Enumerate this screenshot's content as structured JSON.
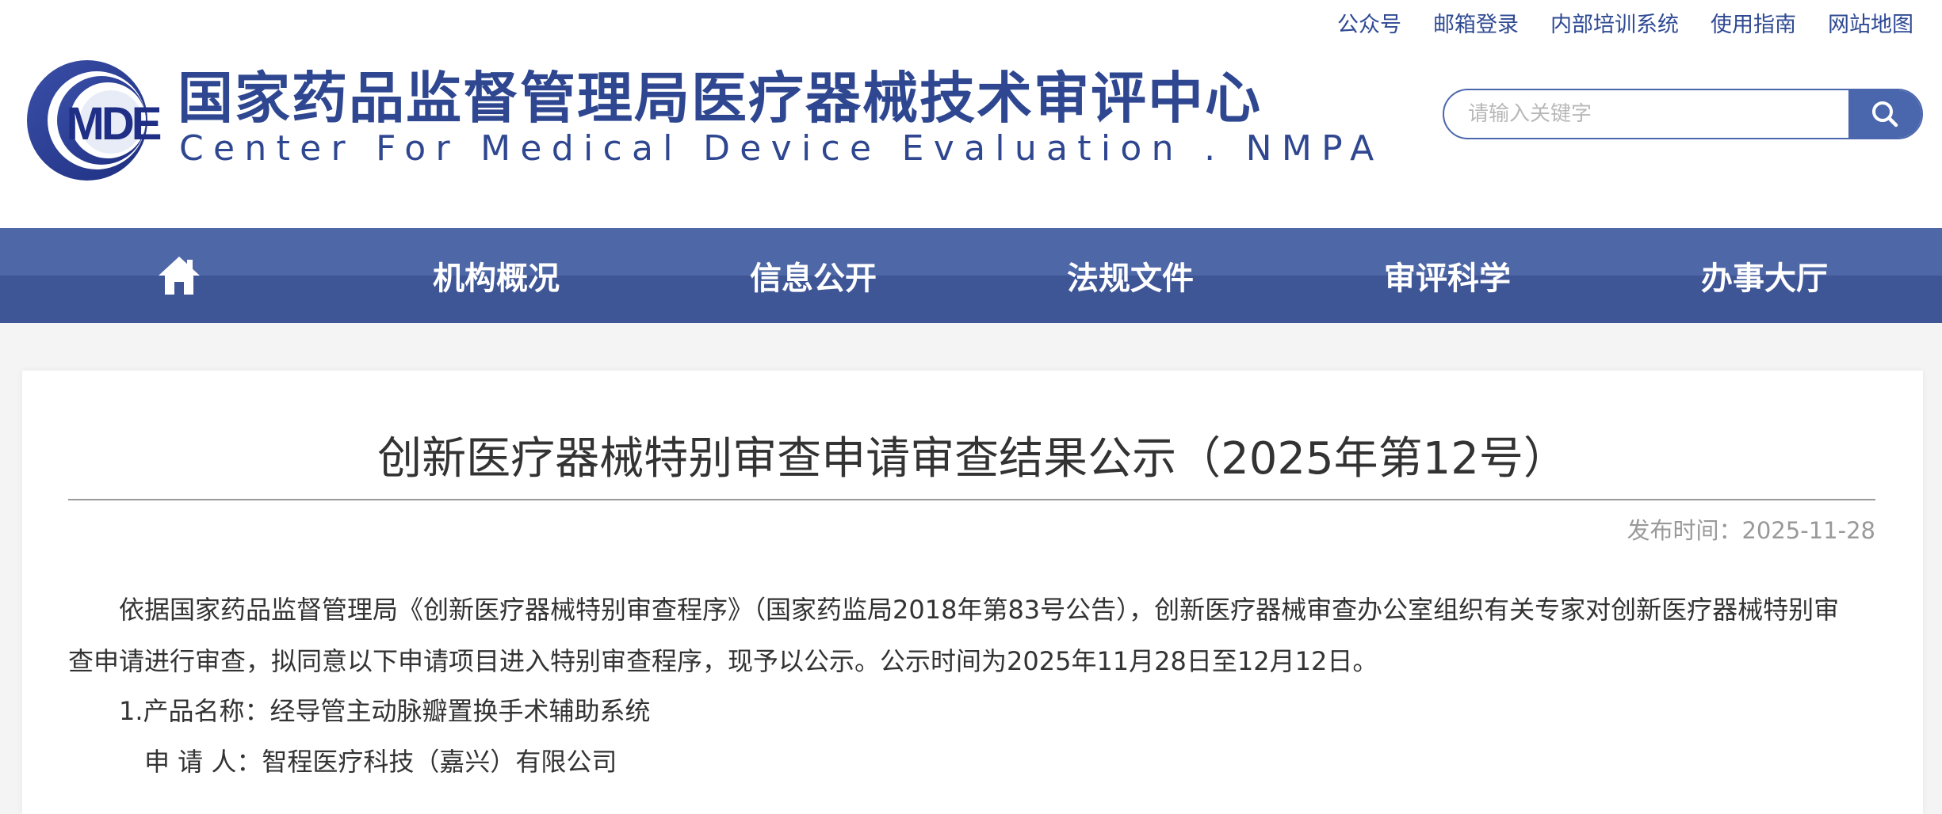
{
  "header": {
    "top_links": [
      "公众号",
      "邮箱登录",
      "内部培训系统",
      "使用指南",
      "网站地图"
    ],
    "logo_text": "MDE",
    "site_title_cn": "国家药品监督管理局医疗器械技术审评中心",
    "site_title_en": "Center For Medical Device Evaluation . NMPA",
    "search": {
      "placeholder": "请输入关键字",
      "value": ""
    }
  },
  "nav": {
    "home_icon": "home-icon",
    "items": [
      "机构概况",
      "信息公开",
      "法规文件",
      "审评科学",
      "办事大厅"
    ]
  },
  "article": {
    "title": "创新医疗器械特别审查申请审查结果公示（2025年第12号）",
    "publish_label": "发布时间：",
    "publish_date": "2025-11-28",
    "para1_line1": "依据国家药品监督管理局《创新医疗器械特别审查程序》（国家药监局2018年第83号公告），创新医疗器械审查办公室组织有关专家对创新医疗器械特别审",
    "para1_line2": "查申请进行审查，拟同意以下申请项目进入特别审查程序，现予以公示。公示时间为2025年11月28日至12月12日。",
    "item1_product": "1.产品名称：经导管主动脉瓣置换手术辅助系统",
    "item1_applicant": "申 请 人：智程医疗科技（嘉兴）有限公司"
  },
  "colors": {
    "brand_blue": "#2e4790",
    "nav_top": "#4e67a6",
    "nav_bottom": "#3e5596",
    "search_blue": "#4a66ad"
  }
}
